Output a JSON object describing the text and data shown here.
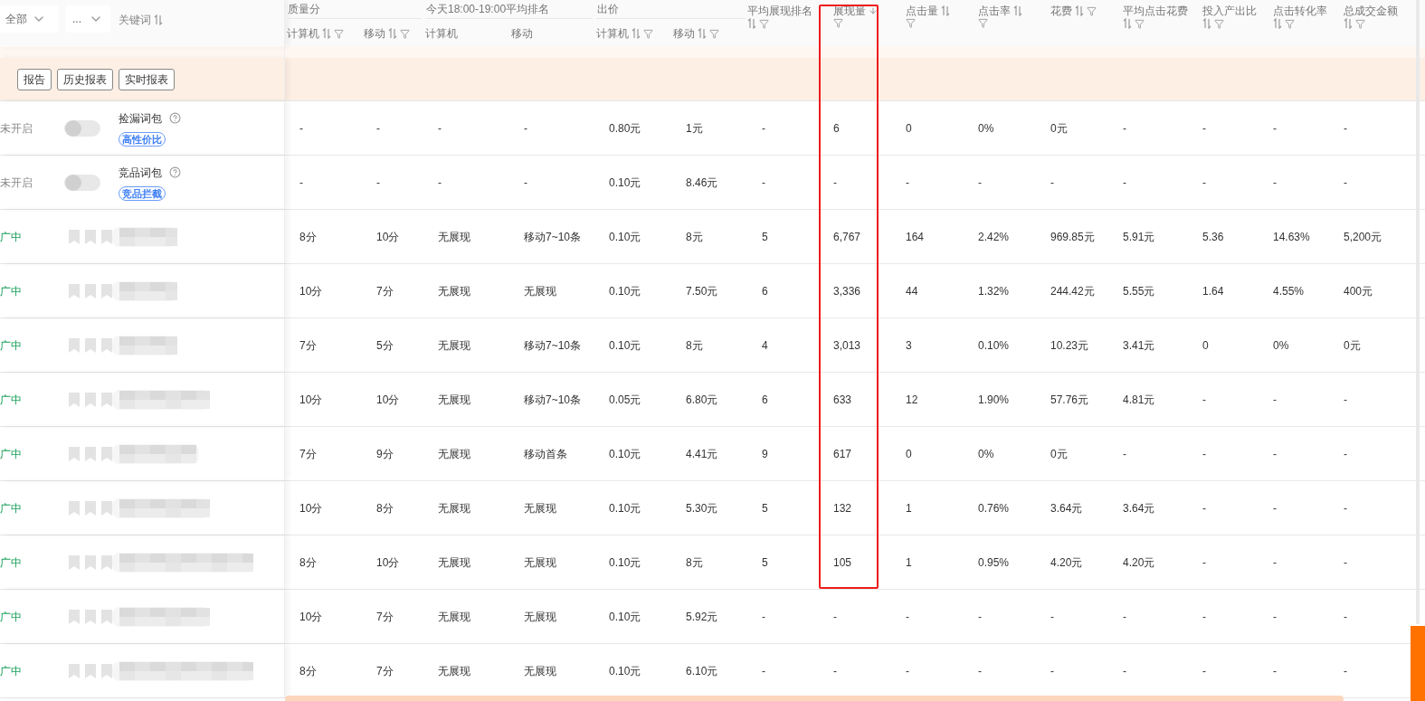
{
  "filters": [
    {
      "value": "全部"
    },
    {
      "value": "..."
    }
  ],
  "keyword_header": {
    "label": "关键词",
    "sorted": false
  },
  "groups": [
    {
      "label": "质量分",
      "columns": [
        {
          "label": "计算机",
          "sorted": false,
          "filter": true
        },
        {
          "label": "移动",
          "sorted": false,
          "filter": true
        }
      ]
    },
    {
      "label": "今天18:00-19:00平均排名",
      "columns": [
        {
          "label": "计算机"
        },
        {
          "label": "移动"
        }
      ]
    },
    {
      "label": "出价",
      "columns": [
        {
          "label": "计算机",
          "sorted": false,
          "filter": true
        },
        {
          "label": "移动",
          "sorted": false,
          "filter": true
        }
      ]
    }
  ],
  "columns": [
    {
      "label": "平均展现排名",
      "sorted": false,
      "filter": true,
      "highlighted": false
    },
    {
      "label": "展现量",
      "sorted": true,
      "filter": true,
      "highlighted": true
    },
    {
      "label": "点击量",
      "sorted": false,
      "filter": true,
      "highlighted": false
    },
    {
      "label": "点击率",
      "sorted": false,
      "filter": true,
      "highlighted": false
    },
    {
      "label": "花费",
      "sorted": false,
      "filter": true,
      "highlighted": false
    },
    {
      "label": "平均点击花费",
      "sorted": false,
      "filter": true,
      "highlighted": false
    },
    {
      "label": "投入产出比",
      "sorted": false,
      "filter": true,
      "highlighted": false
    },
    {
      "label": "点击转化率",
      "sorted": false,
      "filter": true,
      "highlighted": false
    },
    {
      "label": "总成交金额",
      "sorted": false,
      "filter": true,
      "highlighted": false
    }
  ],
  "toolbar": [
    "报告",
    "历史报表",
    "实时报表"
  ],
  "rows": [
    {
      "status": "未开启",
      "kind": "package",
      "on": false,
      "name": "捡漏词包",
      "tag": "高性价比",
      "cells": [
        "-",
        "-",
        "-",
        "-",
        "0.80元",
        "1元",
        "-",
        "6",
        "0",
        "0%",
        "0元",
        "-",
        "-",
        "-",
        "-"
      ]
    },
    {
      "status": "未开启",
      "kind": "package",
      "on": false,
      "name": "竞品词包",
      "tag": "竞品拦截",
      "cells": [
        "-",
        "-",
        "-",
        "-",
        "0.10元",
        "8.46元",
        "-",
        "-",
        "-",
        "-",
        "-",
        "-",
        "-",
        "-",
        "-"
      ]
    },
    {
      "status": "广中",
      "kind": "keyword",
      "cells": [
        "8分",
        "10分",
        "无展现",
        "移动7~10条",
        "0.10元",
        "8元",
        "5",
        "6,767",
        "164",
        "2.42%",
        "969.85元",
        "5.91元",
        "5.36",
        "14.63%",
        "5,200元"
      ]
    },
    {
      "status": "广中",
      "kind": "keyword",
      "cells": [
        "10分",
        "7分",
        "无展现",
        "无展现",
        "0.10元",
        "7.50元",
        "6",
        "3,336",
        "44",
        "1.32%",
        "244.42元",
        "5.55元",
        "1.64",
        "4.55%",
        "400元"
      ]
    },
    {
      "status": "广中",
      "kind": "keyword",
      "cells": [
        "7分",
        "5分",
        "无展现",
        "移动7~10条",
        "0.10元",
        "8元",
        "4",
        "3,013",
        "3",
        "0.10%",
        "10.23元",
        "3.41元",
        "0",
        "0%",
        "0元"
      ]
    },
    {
      "status": "广中",
      "kind": "keyword",
      "cells": [
        "10分",
        "10分",
        "无展现",
        "移动7~10条",
        "0.05元",
        "6.80元",
        "6",
        "633",
        "12",
        "1.90%",
        "57.76元",
        "4.81元",
        "-",
        "-",
        "-"
      ]
    },
    {
      "status": "广中",
      "kind": "keyword",
      "cells": [
        "7分",
        "9分",
        "无展现",
        "移动首条",
        "0.10元",
        "4.41元",
        "9",
        "617",
        "0",
        "0%",
        "0元",
        "-",
        "-",
        "-",
        "-"
      ]
    },
    {
      "status": "广中",
      "kind": "keyword",
      "cells": [
        "10分",
        "8分",
        "无展现",
        "无展现",
        "0.10元",
        "5.30元",
        "5",
        "132",
        "1",
        "0.76%",
        "3.64元",
        "3.64元",
        "-",
        "-",
        "-"
      ]
    },
    {
      "status": "广中",
      "kind": "keyword",
      "cells": [
        "8分",
        "10分",
        "无展现",
        "无展现",
        "0.10元",
        "8元",
        "5",
        "105",
        "1",
        "0.95%",
        "4.20元",
        "4.20元",
        "-",
        "-",
        "-"
      ]
    },
    {
      "status": "广中",
      "kind": "keyword",
      "cells": [
        "10分",
        "7分",
        "无展现",
        "无展现",
        "0.10元",
        "5.92元",
        "-",
        "-",
        "-",
        "-",
        "-",
        "-",
        "-",
        "-",
        "-"
      ]
    },
    {
      "status": "广中",
      "kind": "keyword",
      "cells": [
        "8分",
        "7分",
        "无展现",
        "无展现",
        "0.10元",
        "6.10元",
        "-",
        "-",
        "-",
        "-",
        "-",
        "-",
        "-",
        "-",
        "-"
      ]
    }
  ]
}
